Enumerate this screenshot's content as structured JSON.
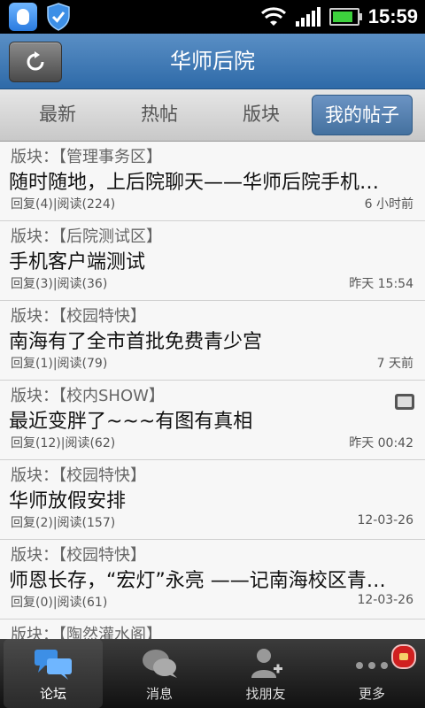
{
  "status_bar": {
    "time": "15:59"
  },
  "header": {
    "title": "华师后院"
  },
  "tabs": [
    {
      "label": "最新"
    },
    {
      "label": "热帖"
    },
    {
      "label": "版块"
    },
    {
      "label": "我的帖子",
      "active": true
    }
  ],
  "posts": [
    {
      "board": "版块：【管理事务区】",
      "title": "随时随地，上后院聊天——华师后院手机…",
      "stats": "回复(4)|阅读(224)",
      "time": "6 小时前"
    },
    {
      "board": "版块：【后院测试区】",
      "title": "手机客户端测试",
      "stats": "回复(3)|阅读(36)",
      "time": "昨天 15:54"
    },
    {
      "board": "版块：【校园特快】",
      "title": "南海有了全市首批免费青少宫",
      "stats": "回复(1)|阅读(79)",
      "time": "7 天前"
    },
    {
      "board": "版块：【校内SHOW】",
      "title": "最近变胖了~~~有图有真相",
      "stats": "回复(12)|阅读(62)",
      "time": "昨天 00:42",
      "has_image": true
    },
    {
      "board": "版块：【校园特快】",
      "title": "华师放假安排",
      "stats": "回复(2)|阅读(157)",
      "time": "12-03-26"
    },
    {
      "board": "版块：【校园特快】",
      "title": "师恩长存，“宏灯”永亮 ——记南海校区青…",
      "stats": "回复(0)|阅读(61)",
      "time": "12-03-26"
    },
    {
      "board": "版块：【陶然灌水阁】",
      "title": "",
      "stats": "",
      "time": ""
    }
  ],
  "bottom_nav": [
    {
      "label": "论坛",
      "icon": "forum-chat-icon",
      "active": true
    },
    {
      "label": "消息",
      "icon": "message-bubble-icon"
    },
    {
      "label": "找朋友",
      "icon": "find-friend-icon"
    },
    {
      "label": "更多",
      "icon": "more-dots-icon",
      "has_badge": true
    }
  ],
  "colors": {
    "accent": "#44719f",
    "title_bar": "#3f77b3"
  }
}
